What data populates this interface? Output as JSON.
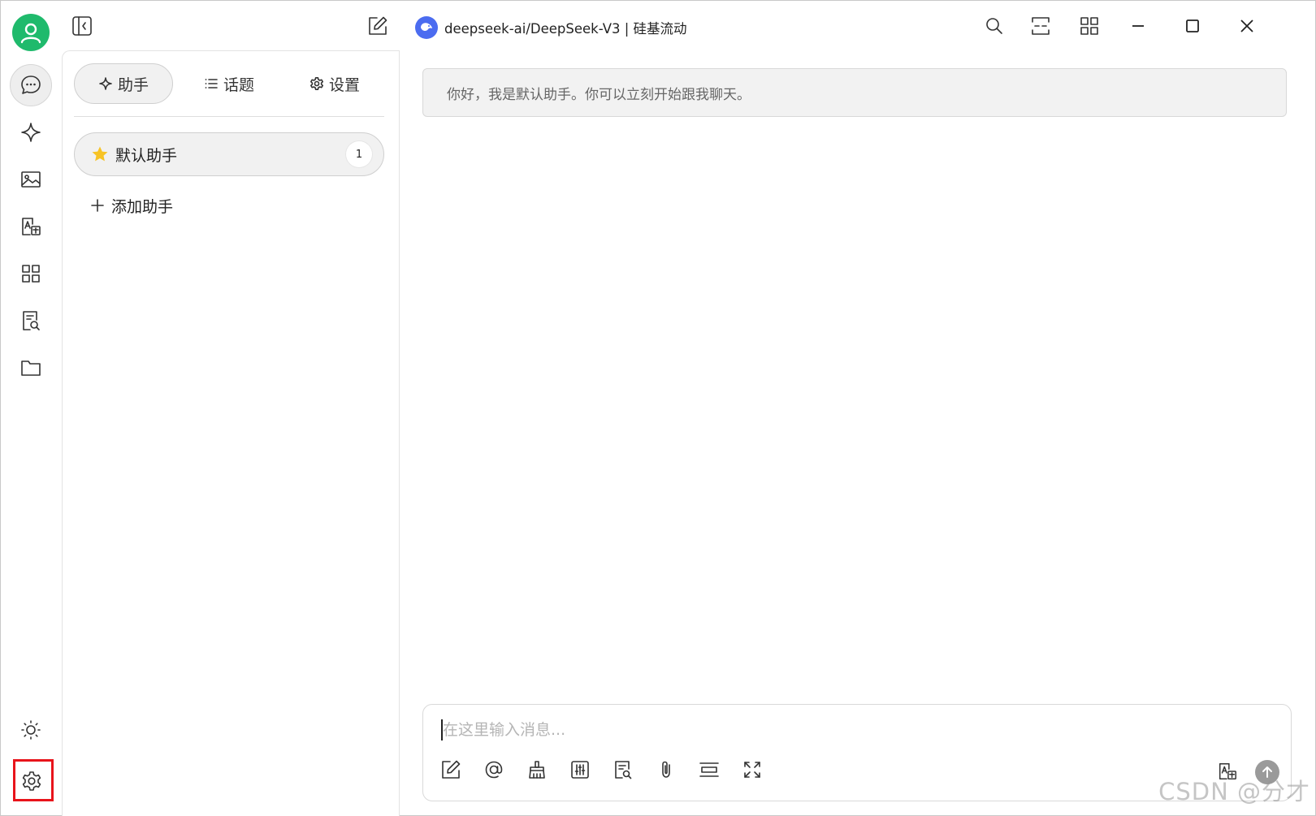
{
  "titlebar": {
    "model_label": "deepseek-ai/DeepSeek-V3 | 硅基流动"
  },
  "sidebar": {
    "tabs": [
      {
        "label": "助手",
        "icon": "sparkle-icon",
        "active": true
      },
      {
        "label": "话题",
        "icon": "list-icon",
        "active": false
      },
      {
        "label": "设置",
        "icon": "gear-icon",
        "active": false
      }
    ],
    "assistants": [
      {
        "name": "默认助手",
        "count": "1",
        "icon": "star-icon"
      }
    ],
    "add_label": "添加助手"
  },
  "rail": {
    "items": [
      "chat-icon",
      "sparkle-icon",
      "image-icon",
      "translate-icon",
      "apps-icon",
      "knowledge-icon",
      "folder-icon"
    ],
    "bottom": [
      "theme-sun-icon",
      "settings-gear-icon"
    ],
    "highlight_color": "#e8141b",
    "avatar_color": "#1fba6c"
  },
  "chat": {
    "welcome": "你好，我是默认助手。你可以立刻开始跟我聊天。",
    "input_placeholder": "在这里输入消息..."
  },
  "watermark": "CSDN @分才"
}
